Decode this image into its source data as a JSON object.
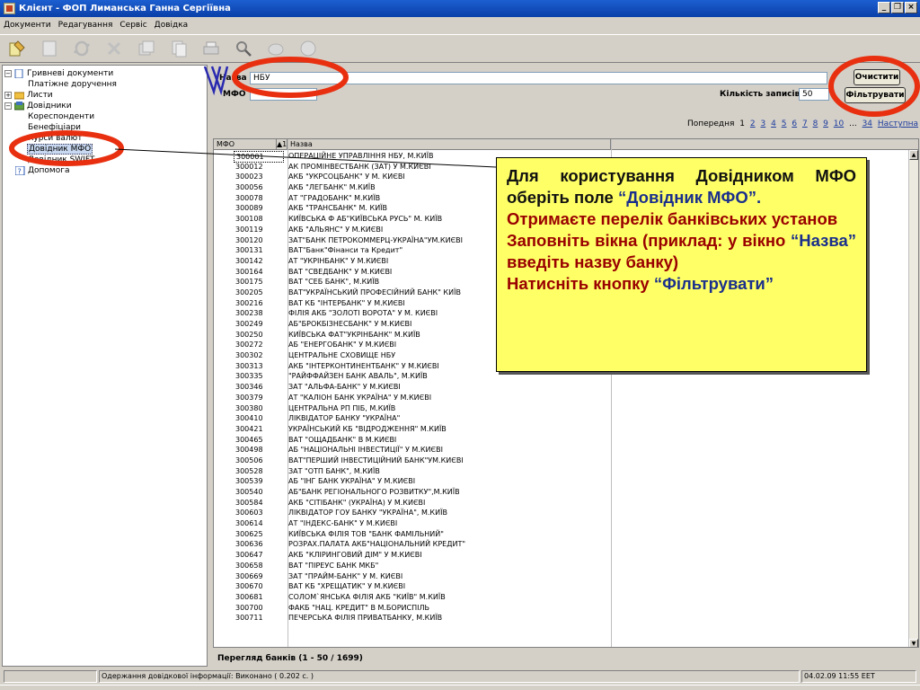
{
  "window": {
    "title": "Клієнт - ФОП Лиманська Ганна Сергіївна",
    "buttons": [
      "_",
      "❐",
      "×"
    ]
  },
  "menu": [
    "Документи",
    "Редагування",
    "Сервіс",
    "Довідка"
  ],
  "tree": {
    "items": [
      {
        "label": "Гривневі документи",
        "expander": "−"
      },
      {
        "label": "Платіжне доручення"
      },
      {
        "label": "Листи",
        "expander": "+"
      },
      {
        "label": "Довідники",
        "expander": "−"
      },
      {
        "label": "Кореспонденти"
      },
      {
        "label": "Бенефіціари"
      },
      {
        "label": "Курси валют"
      },
      {
        "label": "Довідник МФО"
      },
      {
        "label": "Довідник SWIFT"
      },
      {
        "label": "Допомога"
      }
    ]
  },
  "filter": {
    "name_label": "Назва",
    "name_value": "НБУ",
    "mfo_label": "МФО",
    "mfo_value": "",
    "count_label": "Кількість записів",
    "count_value": "50",
    "clear_button": "Очистити",
    "filter_button": "Фільтрувати"
  },
  "pager": {
    "prev": "Попередня",
    "current": "1",
    "pages": [
      "2",
      "3",
      "4",
      "5",
      "6",
      "7",
      "8",
      "9",
      "10"
    ],
    "ellipsis": "...",
    "last": "34",
    "next": "Наступна"
  },
  "grid": {
    "columns": [
      "МФО",
      "▲1",
      "Назва"
    ],
    "rows": [
      [
        "300001",
        "ОПЕРАЦІЙНЕ УПРАВЛІННЯ НБУ, М.КИЇВ"
      ],
      [
        "300012",
        "АК ПРОМІНВЕСТБАНК (ЗАТ) У М.КИЄВІ"
      ],
      [
        "300023",
        "АКБ \"УКРСОЦБАНК\" У М. КИЄВІ"
      ],
      [
        "300056",
        "АКБ \"ЛЕГБАНК\" М.КИЇВ"
      ],
      [
        "300078",
        "АТ \"ГРАДОБАНК\" М.КИЇВ"
      ],
      [
        "300089",
        "АКБ \"ТРАНСБАНК\" М. КИЇВ"
      ],
      [
        "300108",
        "КИЇВСЬКА Ф АБ\"КИЇВСЬКА РУСЬ\" М. КИЇВ"
      ],
      [
        "300119",
        "АКБ \"АЛЬЯНС\" У М.КИЄВІ"
      ],
      [
        "300120",
        "ЗАТ\"БАНК ПЕТРОКОММЕРЦ-УКРАЇНА\"УМ.КИЄВІ"
      ],
      [
        "300131",
        "ВАТ\"Банк\"Фінанси та Кредит\""
      ],
      [
        "300142",
        "АТ \"УКРІНБАНК\" У М.КИЄВІ"
      ],
      [
        "300164",
        "ВАТ \"СВЕДБАНК\" У М.КИЄВІ"
      ],
      [
        "300175",
        "ВАТ \"СЕБ БАНК\", М.КИЇВ"
      ],
      [
        "300205",
        "ВАТ\"УКРАЇНСЬКИЙ ПРОФЕСІЙНИЙ БАНК\" КИЇВ"
      ],
      [
        "300216",
        "ВАТ КБ \"ІНТЕРБАНК\" У М.КИЄВІ"
      ],
      [
        "300238",
        "ФІЛІЯ АКБ \"ЗОЛОТІ ВОРОТА\" У М. КИЄВІ"
      ],
      [
        "300249",
        "АБ\"БРОКБІЗНЕСБАНК\" У М.КИЄВІ"
      ],
      [
        "300250",
        "КИЇВСЬКА ФАТ\"УКРІНБАНК\" М.КИЇВ"
      ],
      [
        "300272",
        "АБ \"ЕНЕРГОБАНК\" У М.КИЄВІ"
      ],
      [
        "300302",
        "ЦЕНТРАЛЬНЕ СХОВИЩЕ НБУ"
      ],
      [
        "300313",
        "АКБ \"ІНТЕРКОНТИНЕНТБАНК\" У М.КИЄВІ"
      ],
      [
        "300335",
        "\"РАЙФФАЙЗЕН БАНК АВАЛЬ\", М.КИЇВ"
      ],
      [
        "300346",
        "ЗАТ \"АЛЬФА-БАНК\" У М.КИЄВІ"
      ],
      [
        "300379",
        "АТ \"КАЛІОН БАНК УКРАЇНА\" У М.КИЄВІ"
      ],
      [
        "300380",
        "ЦЕНТРАЛЬНА РП ПІБ, М.КИЇВ"
      ],
      [
        "300410",
        "ЛІКВІДАТОР БАНКУ \"УКРАЇНА\""
      ],
      [
        "300421",
        "УКРАЇНСЬКИЙ КБ \"ВІДРОДЖЕННЯ\" М.КИЇВ"
      ],
      [
        "300465",
        "ВАТ \"ОЩАДБАНК\" В М.КИЄВІ"
      ],
      [
        "300498",
        "АБ \"НАЦІОНАЛЬНІ ІНВЕСТИЦІЇ\" У М.КИЄВІ"
      ],
      [
        "300506",
        "ВАТ\"ПЕРШИЙ ІНВЕСТИЦІЙНИЙ БАНК\"УМ.КИЄВІ"
      ],
      [
        "300528",
        "ЗАТ \"ОТП БАНК\", М.КИЇВ"
      ],
      [
        "300539",
        "АБ \"ІНГ БАНК УКРАЇНА\" У М.КИЄВІ"
      ],
      [
        "300540",
        "АБ\"БАНК РЕГІОНАЛЬНОГО РОЗВИТКУ\",М.КИЇВ"
      ],
      [
        "300584",
        "АКБ \"СІТІБАНК\" (УКРАЇНА) У М.КИЄВІ"
      ],
      [
        "300603",
        "ЛІКВІДАТОР ГОУ БАНКУ \"УКРАЇНА\", М.КИЇВ"
      ],
      [
        "300614",
        "АТ \"ІНДЕКС-БАНК\" У М.КИЄВІ"
      ],
      [
        "300625",
        "КИЇВСЬКА ФІЛІЯ ТОВ \"БАНК ФАМІЛЬНИЙ\""
      ],
      [
        "300636",
        "РОЗРАХ.ПАЛАТА АКБ\"НАЦІОНАЛЬНИЙ КРЕДИТ\""
      ],
      [
        "300647",
        "АКБ \"КЛІРИНГОВИЙ ДІМ\" У М.КИЄВІ"
      ],
      [
        "300658",
        "ВАТ \"ПІРЕУС БАНК МКБ\""
      ],
      [
        "300669",
        "ЗАТ \"ПРАЙМ-БАНК\" У М. КИЄВІ"
      ],
      [
        "300670",
        "ВАТ КБ \"ХРЕЩАТИК\" У М.КИЄВІ"
      ],
      [
        "300681",
        "СОЛОМ`ЯНСЬКА ФІЛІЯ АКБ \"КИЇВ\" М.КИЇВ"
      ],
      [
        "300700",
        "ФАКБ \"НАЦ. КРЕДИТ\" В М.БОРИСПІЛЬ"
      ],
      [
        "300711",
        "ПЕЧЕРСЬКА ФІЛІЯ ПРИВАТБАНКУ, М.КИЇВ"
      ]
    ]
  },
  "grid_status": "Перегляд банків   (1 - 50 / 1699)",
  "statusbar": {
    "message": "Одержання довідкової інформації: Виконано ( 0.202 с. )",
    "datetime": "04.02.09 11:55 EET"
  },
  "callout": {
    "p1_text": "Для користування Довідником МФО оберіть поле ",
    "p1_quote": "“Довідник МФО”.",
    "p2": "Отримаєте перелік банківських установ",
    "p3_text": "Заповніть вікна (приклад: у вікно ",
    "p3_quote": "“Назва”",
    "p3_tail": " введіть назву банку)",
    "p4_text": "Натисніть кнопку ",
    "p4_quote": "“Фільтрувати”"
  },
  "colors": {
    "titlebar": "#0a3fa8",
    "callout_bg": "#ffff66",
    "callout_text": "#990000",
    "callout_quote": "#1a2f8c",
    "annotation_red": "#e83010",
    "annotation_blue": "#2a2ab0"
  },
  "icons": [
    "app-icon",
    "new-doc-icon",
    "sheet-icon",
    "refresh-icon",
    "delete-icon",
    "stack-icon",
    "copy-icon",
    "print-icon",
    "search-icon",
    "find-icon",
    "help-icon",
    "folder-icon",
    "book-icon",
    "doc-icon"
  ]
}
